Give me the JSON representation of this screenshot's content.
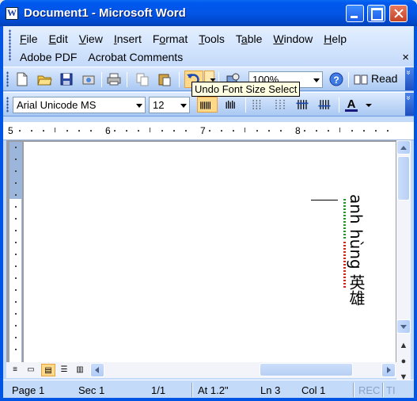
{
  "window": {
    "title": "Document1 - Microsoft Word"
  },
  "menubar": {
    "items": [
      {
        "label": "File",
        "u": "F"
      },
      {
        "label": "Edit",
        "u": "E"
      },
      {
        "label": "View",
        "u": "V"
      },
      {
        "label": "Insert",
        "u": "I"
      },
      {
        "label": "Format",
        "u": "o"
      },
      {
        "label": "Tools",
        "u": "T"
      },
      {
        "label": "Table",
        "u": "a"
      },
      {
        "label": "Window",
        "u": "W"
      },
      {
        "label": "Help",
        "u": "H"
      }
    ],
    "row2": [
      "Adobe PDF",
      "Acrobat Comments"
    ],
    "close_glyph": "×"
  },
  "toolbar_standard": {
    "zoom": "100%",
    "read_label": "Read"
  },
  "toolbar_formatting": {
    "font": "Arial Unicode MS",
    "size": "12"
  },
  "tooltip": "Undo Font Size Select",
  "ruler": {
    "numbers": [
      "5",
      "6",
      "7",
      "8"
    ]
  },
  "document": {
    "vertical_text": "anh hùng 英雄"
  },
  "statusbar": {
    "page": "Page 1",
    "sec": "Sec 1",
    "pages": "1/1",
    "at": "At 1.2\"",
    "ln": "Ln 3",
    "col": "Col 1",
    "rec": "REC",
    "trk": "TI"
  },
  "colors": {
    "titlebar": "#0055E5",
    "toolbar": "#C3DAF9",
    "highlight": "#FFD98A"
  }
}
